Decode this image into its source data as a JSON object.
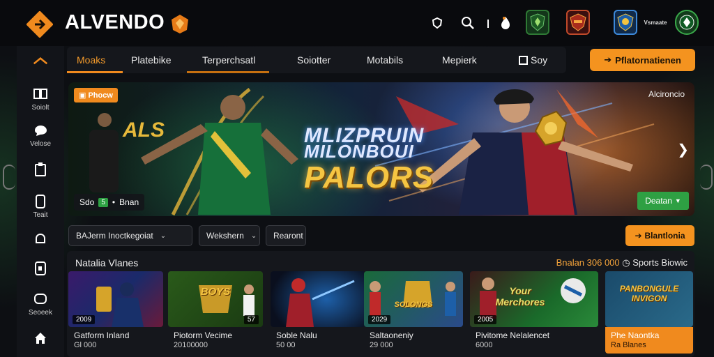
{
  "brand": {
    "name": "ALVENDO",
    "accent": "#f4931f"
  },
  "header": {
    "icons": [
      "shield-outline-icon",
      "search-icon",
      "info-icon",
      "fire-icon"
    ],
    "clubs": [
      "club-crest-green",
      "club-crest-red",
      "club-crest-blue",
      "club-crest-label",
      "club-crest-green-2"
    ],
    "club_label": "Vsmaate"
  },
  "rail": {
    "items": [
      {
        "icon": "cards-icon",
        "label": "Soiolt"
      },
      {
        "icon": "chat-icon",
        "label": "Velose"
      },
      {
        "icon": "clipboard-icon",
        "label": ""
      },
      {
        "icon": "phone-icon",
        "label": "Teait"
      },
      {
        "icon": "bell-icon",
        "label": ""
      },
      {
        "icon": "tablet-icon",
        "label": ""
      },
      {
        "icon": "search-box-icon",
        "label": "Seoeek"
      },
      {
        "icon": "home-icon",
        "label": ""
      }
    ]
  },
  "nav": {
    "tabs": [
      {
        "label": "Moaks",
        "active": true
      },
      {
        "label": "Platebike",
        "active": false
      },
      {
        "label": "Terperchsatl",
        "active": false
      },
      {
        "label": "Soiotter",
        "active": false
      },
      {
        "label": "Motabils",
        "active": false
      },
      {
        "label": "Mepierk",
        "active": false
      },
      {
        "label": "Soy",
        "active": false
      }
    ],
    "cta": "Pflatornatienen"
  },
  "hero": {
    "tag": "Phocw",
    "corner": "Alcironcio",
    "als": "ALS",
    "title_line1": "MLIZPRUIN",
    "title_line2": "MILONBOUI",
    "title_line3": "PALORS",
    "score_left": "Sdo",
    "score_mid": "5",
    "score_right": "Bnan",
    "button": "Deatan"
  },
  "filters": {
    "primary": "BAJerm  Inoctkegoiat",
    "secondary": "Wekshern",
    "tertiary": "Rearont",
    "cta": "Blantlonia"
  },
  "games": {
    "title": "Natalia Vlanes",
    "right_orange": "Bnalan 306 000",
    "right_white": "Sports Biowic",
    "cards": [
      {
        "name": "Gatform Inland",
        "sub": "Gl 000",
        "badge": "2009",
        "badge_r": "",
        "art": ""
      },
      {
        "name": "Piotorm Vecime",
        "sub": "20100000",
        "badge": "",
        "badge_r": "57",
        "art": "BOYS"
      },
      {
        "name": "Soble Nalu",
        "sub": "50 00",
        "badge": "",
        "badge_r": "",
        "art": ""
      },
      {
        "name": "Saltaoneniy",
        "sub": "29 000",
        "badge": "2029",
        "badge_r": "",
        "art": "SOLONGS"
      },
      {
        "name": "Pivitome Nelalencet",
        "sub": "6000",
        "badge": "2005",
        "badge_r": "",
        "art": "Your Merchores"
      },
      {
        "name": "Phe Naontka",
        "sub": "Ra Blanes",
        "badge": "",
        "badge_r": "",
        "art": "PANBONGULE INVIGON"
      }
    ]
  }
}
